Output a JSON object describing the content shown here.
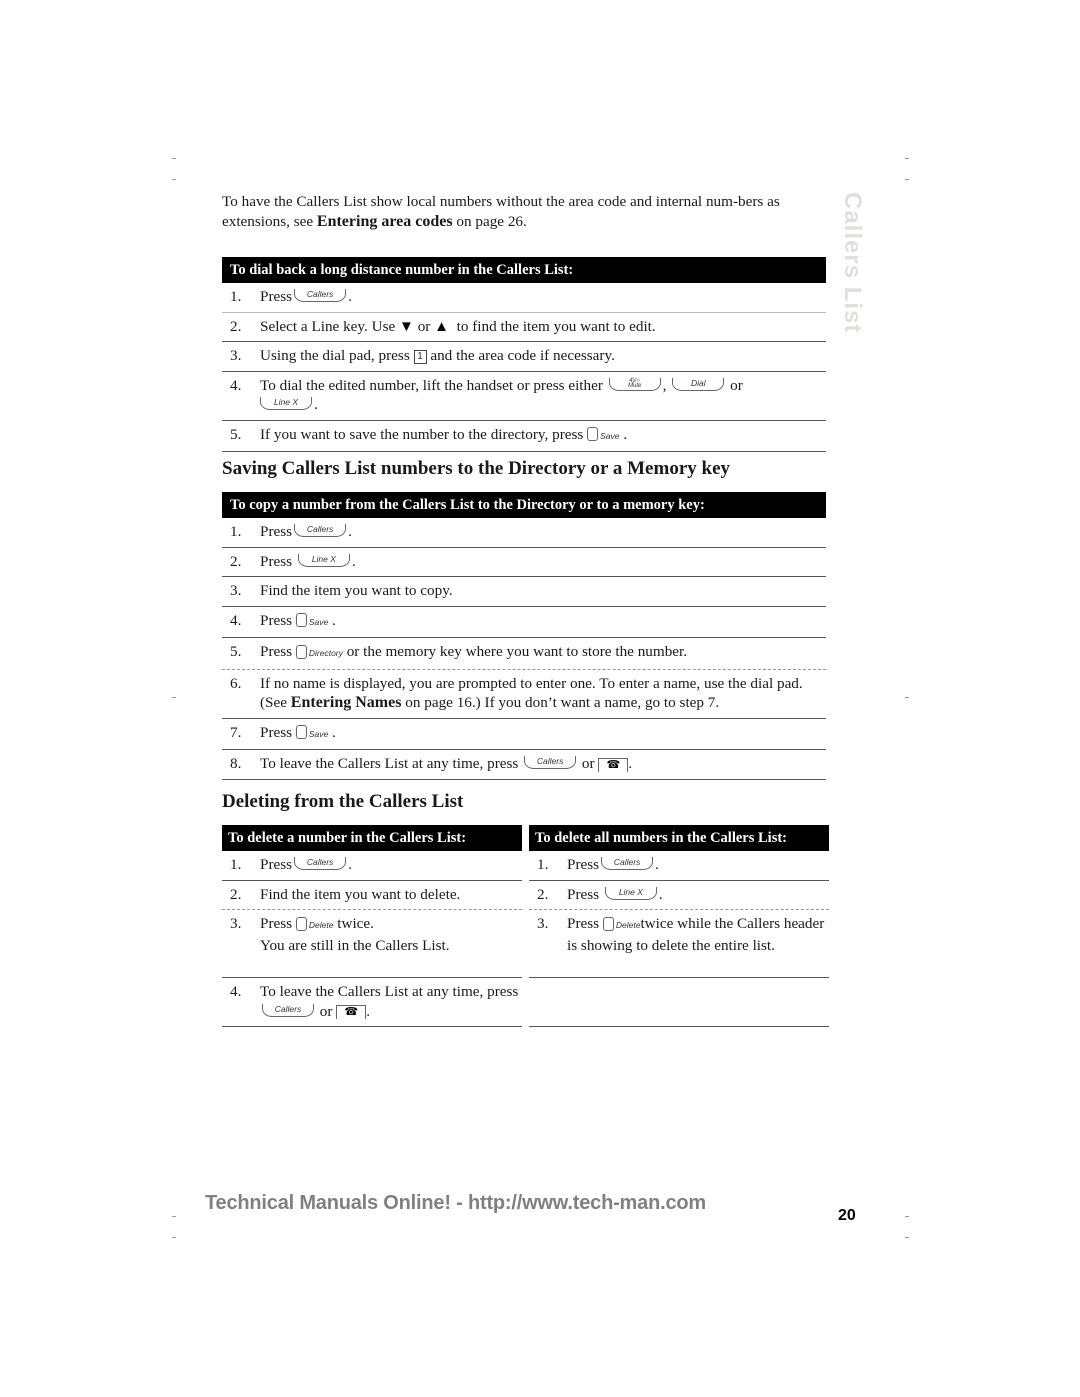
{
  "side_tab": "Callers List",
  "intro": {
    "before": "To have the Callers List show local numbers without the area code and internal num-bers as extensions, see ",
    "link": "Entering area codes",
    "after": " on page 26."
  },
  "table_dial_back": {
    "header": "To dial back a long distance number in the Callers List:",
    "steps": [
      {
        "n": "1.",
        "pre": "Press",
        "key": "Callers",
        "post": "."
      },
      {
        "n": "2.",
        "pre": "Select a Line key. Use",
        "mid": "or",
        "post": "to find the item you want to edit."
      },
      {
        "n": "3.",
        "pre": "Using the dial pad, press",
        "key": "1",
        "post": "and the area code if necessary."
      },
      {
        "n": "4.",
        "pre": "To dial the edited number, lift the handset or press either",
        "key1": "Handsfree/Mute",
        "key2": "Dial",
        "or": "or",
        "key3": "Line X",
        "post": "."
      },
      {
        "n": "5.",
        "pre": "If you want to save the number to the directory, press",
        "key": "Save",
        "post": "."
      }
    ]
  },
  "section_saving": {
    "title": "Saving Callers List numbers to the Directory or a Memory key",
    "header": "To copy a number from the Callers List to the Directory or to a memory key:",
    "steps": [
      {
        "n": "1.",
        "pre": "Press",
        "key": "Callers",
        "post": "."
      },
      {
        "n": "2.",
        "pre": "Press",
        "key": "Line X",
        "post": "."
      },
      {
        "n": "3.",
        "text": "Find the item you want to copy."
      },
      {
        "n": "4.",
        "pre": "Press",
        "key": "Save",
        "post": "."
      },
      {
        "n": "5.",
        "pre": "Press",
        "key": "Directory",
        "post": "or the memory key where you want to store the number."
      },
      {
        "n": "6.",
        "pre": "If no name is displayed, you are prompted to enter one. To enter a name, use the dial pad. (See ",
        "link": "Entering Names",
        "post": " on page 16.) If you don’t want a name, go to step 7."
      },
      {
        "n": "7.",
        "pre": "Press",
        "key": "Save",
        "post": "."
      },
      {
        "n": "8.",
        "pre": "To leave the Callers List at any time, press",
        "key": "Callers",
        "or": "or",
        "post": "."
      }
    ]
  },
  "section_deleting": {
    "title": "Deleting from the Callers List",
    "left": {
      "header": "To delete a number in the Callers List:",
      "steps": [
        {
          "n": "1.",
          "pre": "Press",
          "key": "Callers",
          "post": "."
        },
        {
          "n": "2.",
          "text": "Find the item you want to delete."
        },
        {
          "n": "3.",
          "pre": "Press",
          "key": "Delete",
          "post": "twice.",
          "line2": "You are still in the Callers List."
        },
        {
          "n": "4.",
          "pre": "To leave the Callers List at any time, press",
          "key": "Callers",
          "or": "or",
          "post": "."
        }
      ]
    },
    "right": {
      "header": "To delete all numbers in the Callers List:",
      "steps": [
        {
          "n": "1.",
          "pre": "Press",
          "key": "Callers",
          "post": "."
        },
        {
          "n": "2.",
          "pre": "Press",
          "key": "Line X",
          "post": "."
        },
        {
          "n": "3.",
          "pre": "Press",
          "key": "Delete",
          "post": "twice while the Callers header is showing to delete the entire list."
        }
      ]
    }
  },
  "footer": {
    "watermark": "Technical Manuals Online! - http://www.tech-man.com",
    "page_number": "20"
  },
  "icons": {
    "down_arrow": "▼",
    "up_arrow": "▲",
    "handset": "☎",
    "mute_label": "4)/○\nMute"
  }
}
